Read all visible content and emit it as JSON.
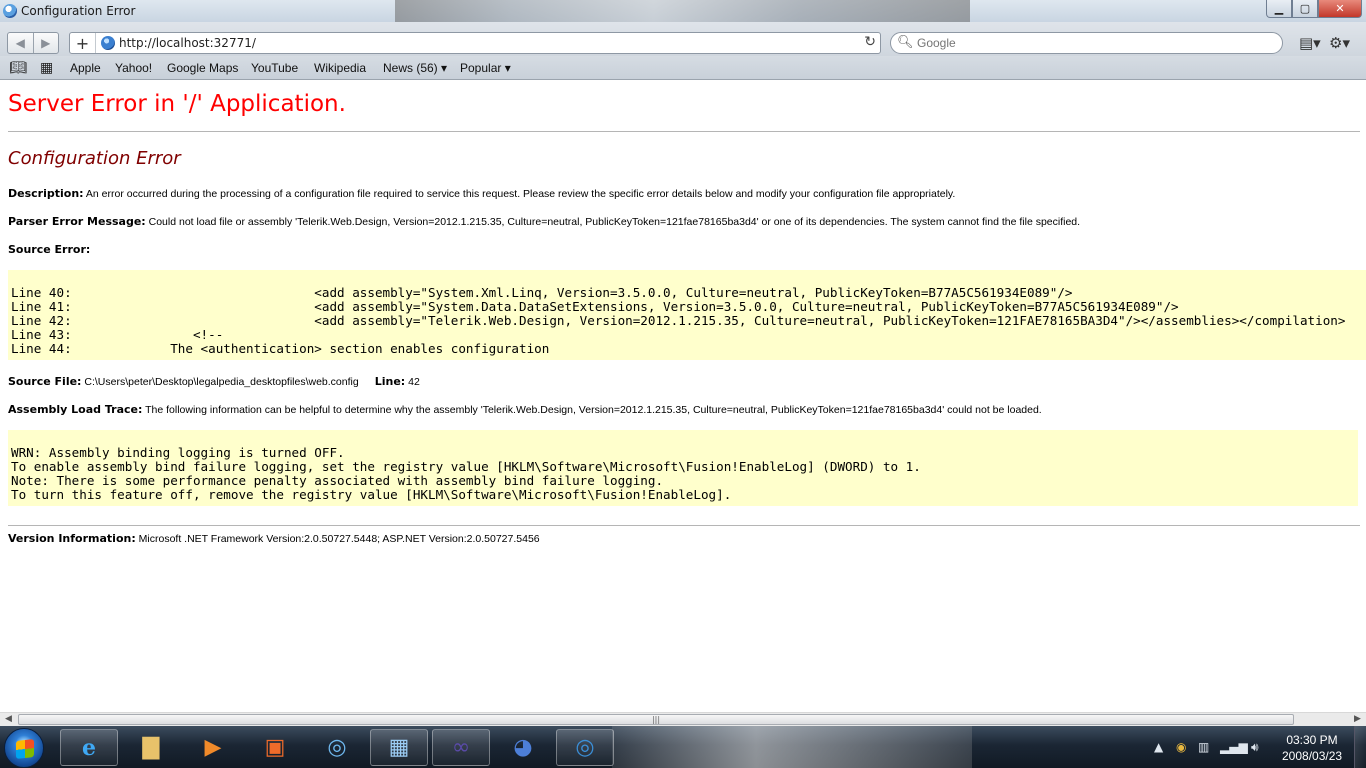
{
  "window": {
    "title": "Configuration Error"
  },
  "toolbar": {
    "url": "http://localhost:32771/",
    "search_placeholder": "Google"
  },
  "bookmarks": [
    "Apple",
    "Yahoo!",
    "Google Maps",
    "YouTube",
    "Wikipedia",
    "News (56) ▾",
    "Popular ▾"
  ],
  "page": {
    "heading": "Server Error in '/' Application.",
    "subheading": "Configuration Error",
    "description_label": "Description:",
    "description_text": " An error occurred during the processing of a configuration file required to service this request. Please review the specific error details below and modify your configuration file appropriately.",
    "parser_label": "Parser Error Message:",
    "parser_text": " Could not load file or assembly 'Telerik.Web.Design, Version=2012.1.215.35, Culture=neutral, PublicKeyToken=121fae78165ba3d4' or one of its dependencies. The system cannot find the file specified.",
    "source_error_label": "Source Error:",
    "source_lines": [
      "Line 40:                                <add assembly=\"System.Xml.Linq, Version=3.5.0.0, Culture=neutral, PublicKeyToken=B77A5C561934E089\"/>",
      "Line 41:                                <add assembly=\"System.Data.DataSetExtensions, Version=3.5.0.0, Culture=neutral, PublicKeyToken=B77A5C561934E089\"/>",
      "Line 42:                                <add assembly=\"Telerik.Web.Design, Version=2012.1.215.35, Culture=neutral, PublicKeyToken=121FAE78165BA3D4\"/></assemblies></compilation>",
      "Line 43:                <!--",
      "Line 44:             The <authentication> section enables configuration"
    ],
    "source_file_label": "Source File:",
    "source_file_path": " C:\\Users\\peter\\Desktop\\legalpedia_desktopfiles\\web.config",
    "line_label": "Line:",
    "line_number": " 42",
    "trace_label": "Assembly Load Trace:",
    "trace_text": " The following information can be helpful to determine why the assembly 'Telerik.Web.Design, Version=2012.1.215.35, Culture=neutral, PublicKeyToken=121fae78165ba3d4' could not be loaded.",
    "trace_lines": [
      "WRN: Assembly binding logging is turned OFF.",
      "To enable assembly bind failure logging, set the registry value [HKLM\\Software\\Microsoft\\Fusion!EnableLog] (DWORD) to 1.",
      "Note: There is some performance penalty associated with assembly bind failure logging.",
      "To turn this feature off, remove the registry value [HKLM\\Software\\Microsoft\\Fusion!EnableLog]."
    ],
    "version_label": "Version Information:",
    "version_text": " Microsoft .NET Framework Version:2.0.50727.5448; ASP.NET Version:2.0.50727.5456"
  },
  "taskbar": {
    "time": "03:30 PM",
    "date": "2008/03/23"
  },
  "colors": {
    "heading": "#ff0000",
    "subheading": "#800000",
    "code_background": "#ffffcc",
    "error_line": "#ff0000"
  }
}
